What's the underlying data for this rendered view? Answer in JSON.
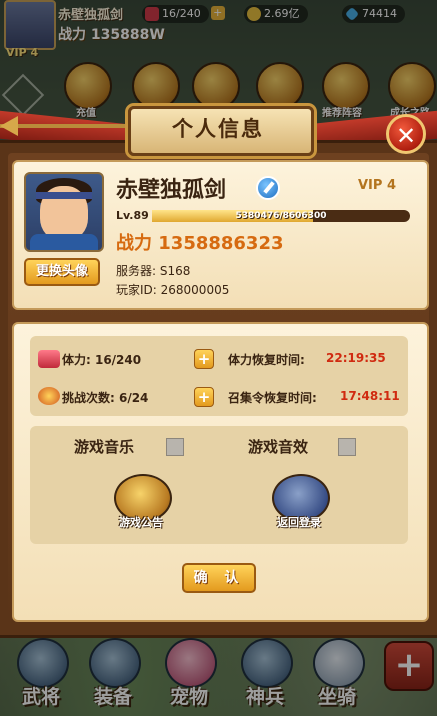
{
  "hud": {
    "player_name": "赤壁独孤剑",
    "power": "战力 135888W",
    "vip": "VIP 4",
    "stamina": "16/240",
    "gold": "2.69亿",
    "gems": "74414",
    "icons": [
      {
        "name": "recharge-icon",
        "label": "充值"
      },
      {
        "name": "event-icon",
        "label": ""
      },
      {
        "name": "gift-icon",
        "label": ""
      },
      {
        "name": "shop-icon",
        "label": ""
      },
      {
        "name": "recommended-lineup-icon",
        "label": "推荐阵容"
      },
      {
        "name": "growth-icon",
        "label": "成长之路"
      }
    ]
  },
  "dialog": {
    "title": "个人信息",
    "close": "✕"
  },
  "profile": {
    "name": "赤壁独孤剑",
    "vip": "VIP 4",
    "level": "Lv.89",
    "xp": "5380476/8606300",
    "xp_fraction": 0.625,
    "power": "战力 1358886323",
    "server": "服务器:  S168",
    "player_id": "玩家ID:  268000005",
    "change_avatar": "更换头像"
  },
  "stats": {
    "stamina_label": "体力: 16/240",
    "stamina_recover_label": "体力恢复时间:",
    "stamina_recover_time": "22:19:35",
    "challenge_label": "挑战次数: 6/24",
    "summon_recover_label": "召集令恢复时间:",
    "summon_recover_time": "17:48:11"
  },
  "options": {
    "music": "游戏音乐",
    "sound": "游戏音效",
    "announcement": "游戏公告",
    "back_login": "返回登录",
    "confirm": "确 认"
  },
  "bottom_nav": [
    "武将",
    "装备",
    "宠物",
    "神兵",
    "坐骑"
  ],
  "colors": {
    "accent": "#e39a1e",
    "danger": "#d02a10",
    "panel": "#5a3418",
    "parchment": "#fdf3dc"
  }
}
